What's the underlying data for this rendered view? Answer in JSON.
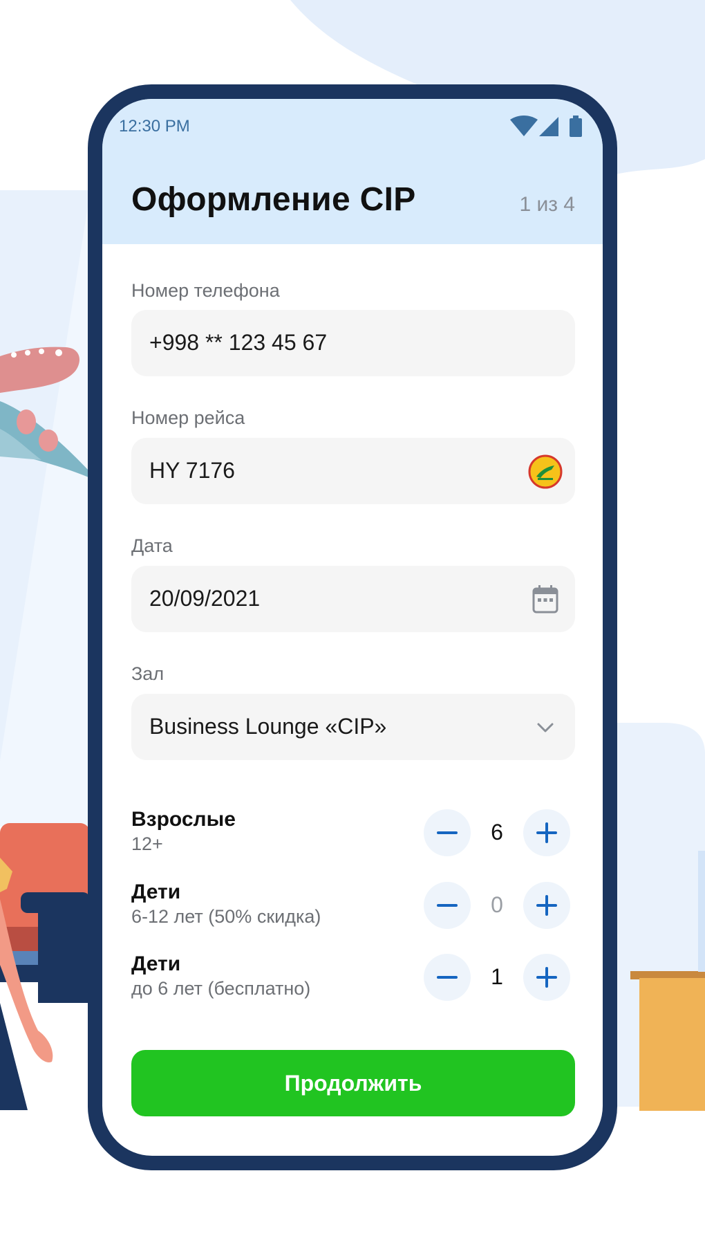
{
  "status_bar": {
    "time": "12:30 PM",
    "icons": [
      "wifi-icon",
      "signal-icon",
      "battery-icon"
    ]
  },
  "header": {
    "title": "Оформление CIP",
    "step": "1 из 4"
  },
  "form": {
    "phone": {
      "label": "Номер телефона",
      "value": "+998 ** 123 45 67"
    },
    "flight": {
      "label": "Номер рейса",
      "value": "HY 7176",
      "icon": "airline-logo-icon"
    },
    "date": {
      "label": "Дата",
      "value": "20/09/2021",
      "icon": "calendar-icon"
    },
    "hall": {
      "label": "Зал",
      "value": "Business Lounge «CIP»",
      "icon": "chevron-down-icon"
    }
  },
  "counters": [
    {
      "title": "Взрослые",
      "subtitle": "12+",
      "value": "6"
    },
    {
      "title": "Дети",
      "subtitle": "6-12 лет (50% скидка)",
      "value": "0"
    },
    {
      "title": "Дети",
      "subtitle": "до 6 лет (бесплатно)",
      "value": "1"
    }
  ],
  "continue_label": "Продолжить",
  "colors": {
    "header_bg": "#d8ebfc",
    "phone_frame": "#1b355f",
    "primary_button": "#21c421",
    "stepper_icon": "#1565c0",
    "field_bg": "#f5f5f5"
  }
}
